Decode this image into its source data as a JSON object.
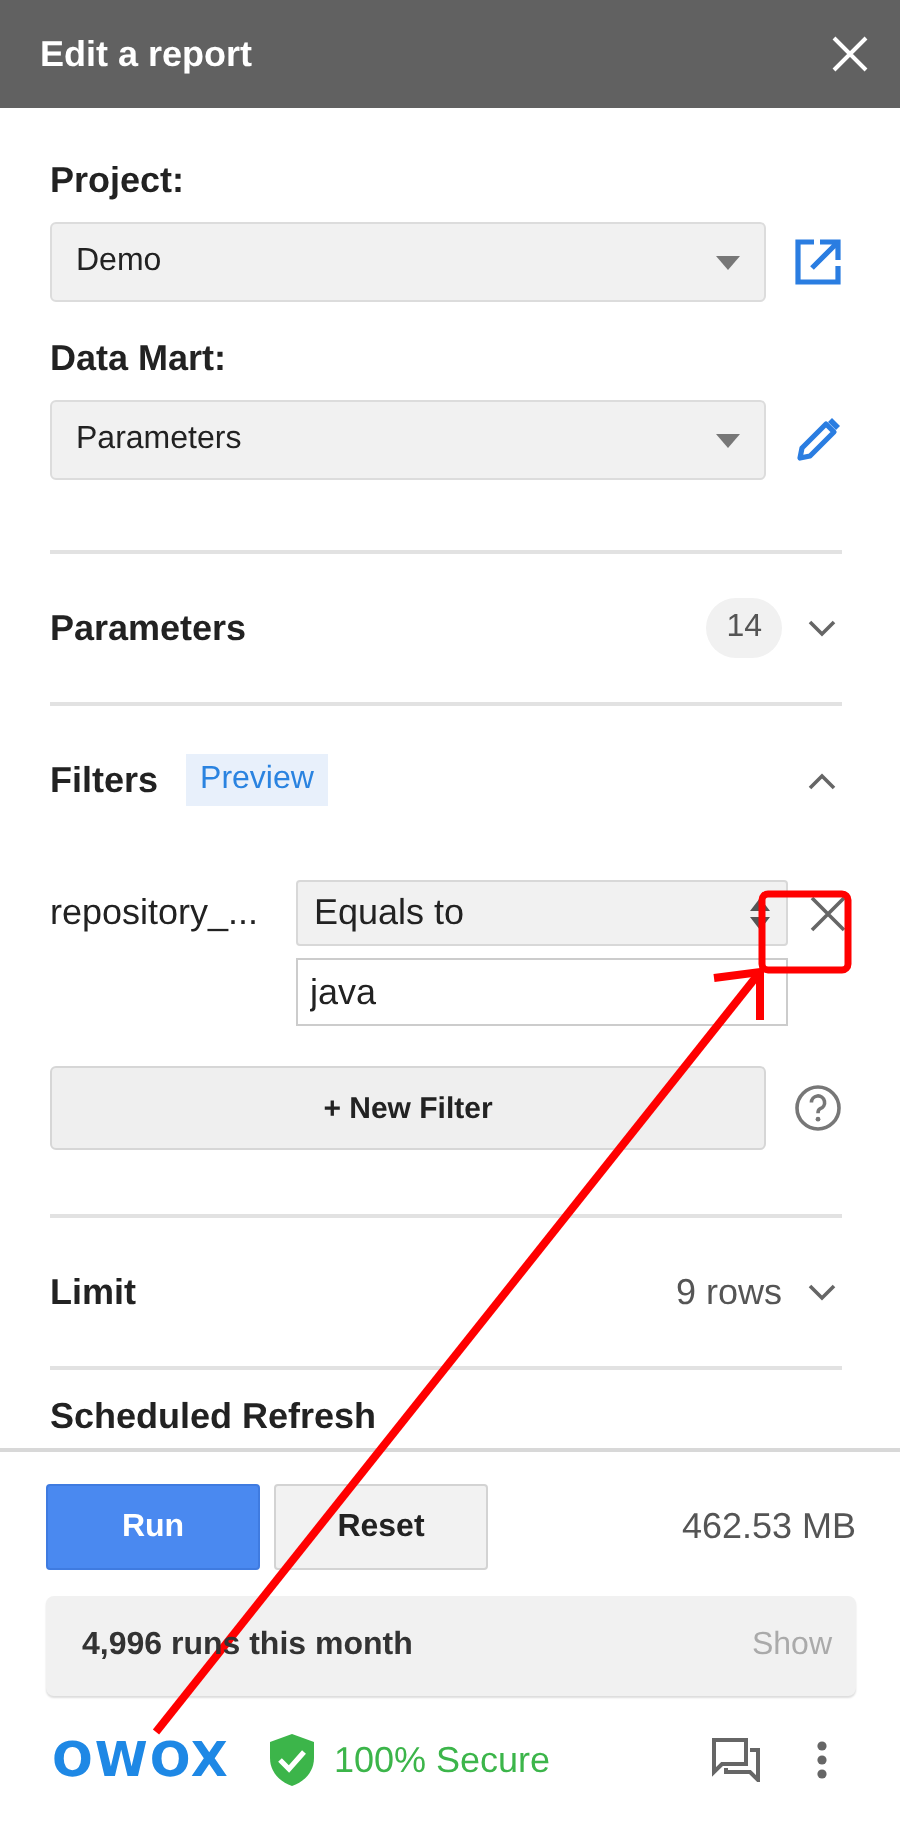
{
  "window": {
    "title": "Edit a report"
  },
  "project": {
    "label": "Project:",
    "value": "Demo"
  },
  "data_mart": {
    "label": "Data Mart:",
    "value": "Parameters"
  },
  "sections": [
    {
      "kind": "count",
      "title": "Parameters",
      "count": "14",
      "expanded": false
    },
    {
      "kind": "filters",
      "title": "Filters",
      "tag": "Preview",
      "expanded": true,
      "filters": [
        {
          "field": "repository_...",
          "operator": "Equals to",
          "value": "java"
        }
      ],
      "new_filter": "+ New Filter"
    },
    {
      "kind": "value",
      "title": "Limit",
      "value": "9 rows",
      "expanded": false
    },
    {
      "kind": "plain",
      "title": "Scheduled Refresh"
    }
  ],
  "actions": {
    "run": "Run",
    "reset": "Reset",
    "size": "462.53 MB"
  },
  "usage": {
    "text": "4,996 runs this month",
    "link": "Show"
  },
  "footer": {
    "logo": "OWOX",
    "secure": "100% Secure"
  },
  "annotation": {
    "kind": "highlight-arrow"
  }
}
